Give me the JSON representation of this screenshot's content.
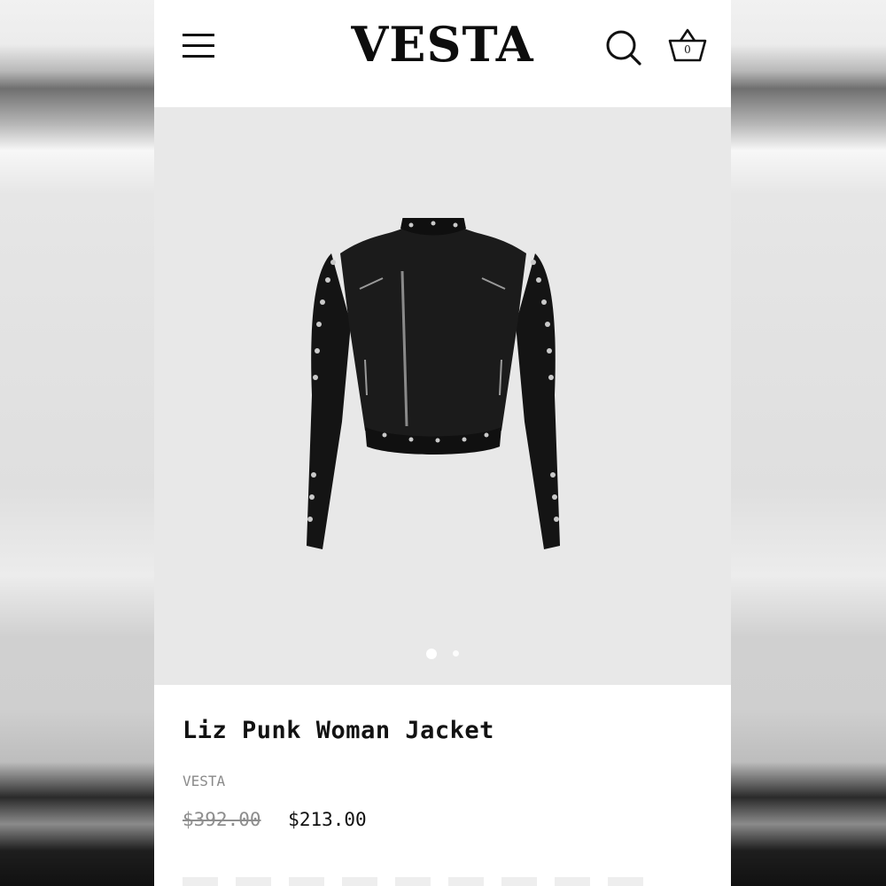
{
  "header": {
    "logo": "VESTA",
    "cart_count": "0"
  },
  "gallery": {
    "slide_count": 2,
    "active_slide": 1
  },
  "product": {
    "title": "Liz Punk Woman Jacket",
    "vendor": "VESTA",
    "compare_price": "$392.00",
    "price": "$213.00"
  },
  "colors": {
    "accent": "#111111",
    "gallery_bg": "#e8e8e8",
    "muted_text": "#8a8a8a"
  }
}
